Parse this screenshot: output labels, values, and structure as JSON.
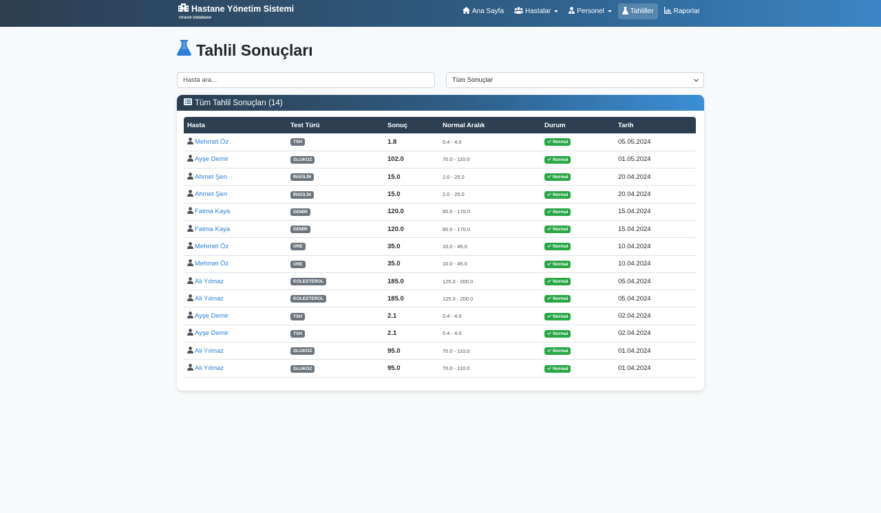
{
  "navbar": {
    "brand_title": "Hastane Yönetim Sistemi",
    "brand_subtitle": "Oracle Database",
    "links": [
      {
        "label": "Ana Sayfa",
        "icon": "home-icon"
      },
      {
        "label": "Hastalar",
        "icon": "users-icon",
        "dropdown": true
      },
      {
        "label": "Personel",
        "icon": "user-tie-icon",
        "dropdown": true
      },
      {
        "label": "Tahliller",
        "icon": "flask-icon",
        "active": true
      },
      {
        "label": "Raporlar",
        "icon": "chart-icon"
      }
    ]
  },
  "page": {
    "title": "Tahlil Sonuçları"
  },
  "filters": {
    "search_placeholder": "Hasta ara...",
    "select_value": "Tüm Sonuçlar"
  },
  "card": {
    "title": "Tüm Tahlil Sonuçları (14)"
  },
  "colors": {
    "header_dark": "#2c3e50",
    "header_light": "#3a8fd6",
    "link_blue": "#2d7fd8",
    "badge_gray": "#6c757d",
    "badge_green": "#28a745"
  },
  "table": {
    "headers": [
      "Hasta",
      "Test Türü",
      "Sonuç",
      "Normal Aralık",
      "Durum",
      "Tarih"
    ],
    "rows": [
      {
        "patient": "Mehmet Öz",
        "test": "TSH",
        "result": "1.8",
        "range": "0.4 - 4.0",
        "status": "Normal",
        "date": "05.05.2024"
      },
      {
        "patient": "Ayşe Demir",
        "test": "GLUKOZ",
        "result": "102.0",
        "range": "70.0 - 110.0",
        "status": "Normal",
        "date": "01.05.2024"
      },
      {
        "patient": "Ahmet Şen",
        "test": "İNSÜLİN",
        "result": "15.0",
        "range": "2.0 - 25.0",
        "status": "Normal",
        "date": "20.04.2024"
      },
      {
        "patient": "Ahmet Şen",
        "test": "İNSÜLİN",
        "result": "15.0",
        "range": "2.0 - 25.0",
        "status": "Normal",
        "date": "20.04.2024"
      },
      {
        "patient": "Fatma Kaya",
        "test": "DEMİR",
        "result": "120.0",
        "range": "60.0 - 170.0",
        "status": "Normal",
        "date": "15.04.2024"
      },
      {
        "patient": "Fatma Kaya",
        "test": "DEMİR",
        "result": "120.0",
        "range": "60.0 - 170.0",
        "status": "Normal",
        "date": "15.04.2024"
      },
      {
        "patient": "Mehmet Öz",
        "test": "ÜRE",
        "result": "35.0",
        "range": "10.0 - 45.0",
        "status": "Normal",
        "date": "10.04.2024"
      },
      {
        "patient": "Mehmet Öz",
        "test": "ÜRE",
        "result": "35.0",
        "range": "10.0 - 45.0",
        "status": "Normal",
        "date": "10.04.2024"
      },
      {
        "patient": "Ali Yılmaz",
        "test": "KOLESTEROL",
        "result": "185.0",
        "range": "125.0 - 200.0",
        "status": "Normal",
        "date": "05.04.2024"
      },
      {
        "patient": "Ali Yılmaz",
        "test": "KOLESTEROL",
        "result": "185.0",
        "range": "125.0 - 200.0",
        "status": "Normal",
        "date": "05.04.2024"
      },
      {
        "patient": "Ayşe Demir",
        "test": "TSH",
        "result": "2.1",
        "range": "0.4 - 4.0",
        "status": "Normal",
        "date": "02.04.2024"
      },
      {
        "patient": "Ayşe Demir",
        "test": "TSH",
        "result": "2.1",
        "range": "0.4 - 4.0",
        "status": "Normal",
        "date": "02.04.2024"
      },
      {
        "patient": "Ali Yılmaz",
        "test": "GLUKOZ",
        "result": "95.0",
        "range": "70.0 - 110.0",
        "status": "Normal",
        "date": "01.04.2024"
      },
      {
        "patient": "Ali Yılmaz",
        "test": "GLUKOZ",
        "result": "95.0",
        "range": "70.0 - 110.0",
        "status": "Normal",
        "date": "01.04.2024"
      }
    ]
  }
}
